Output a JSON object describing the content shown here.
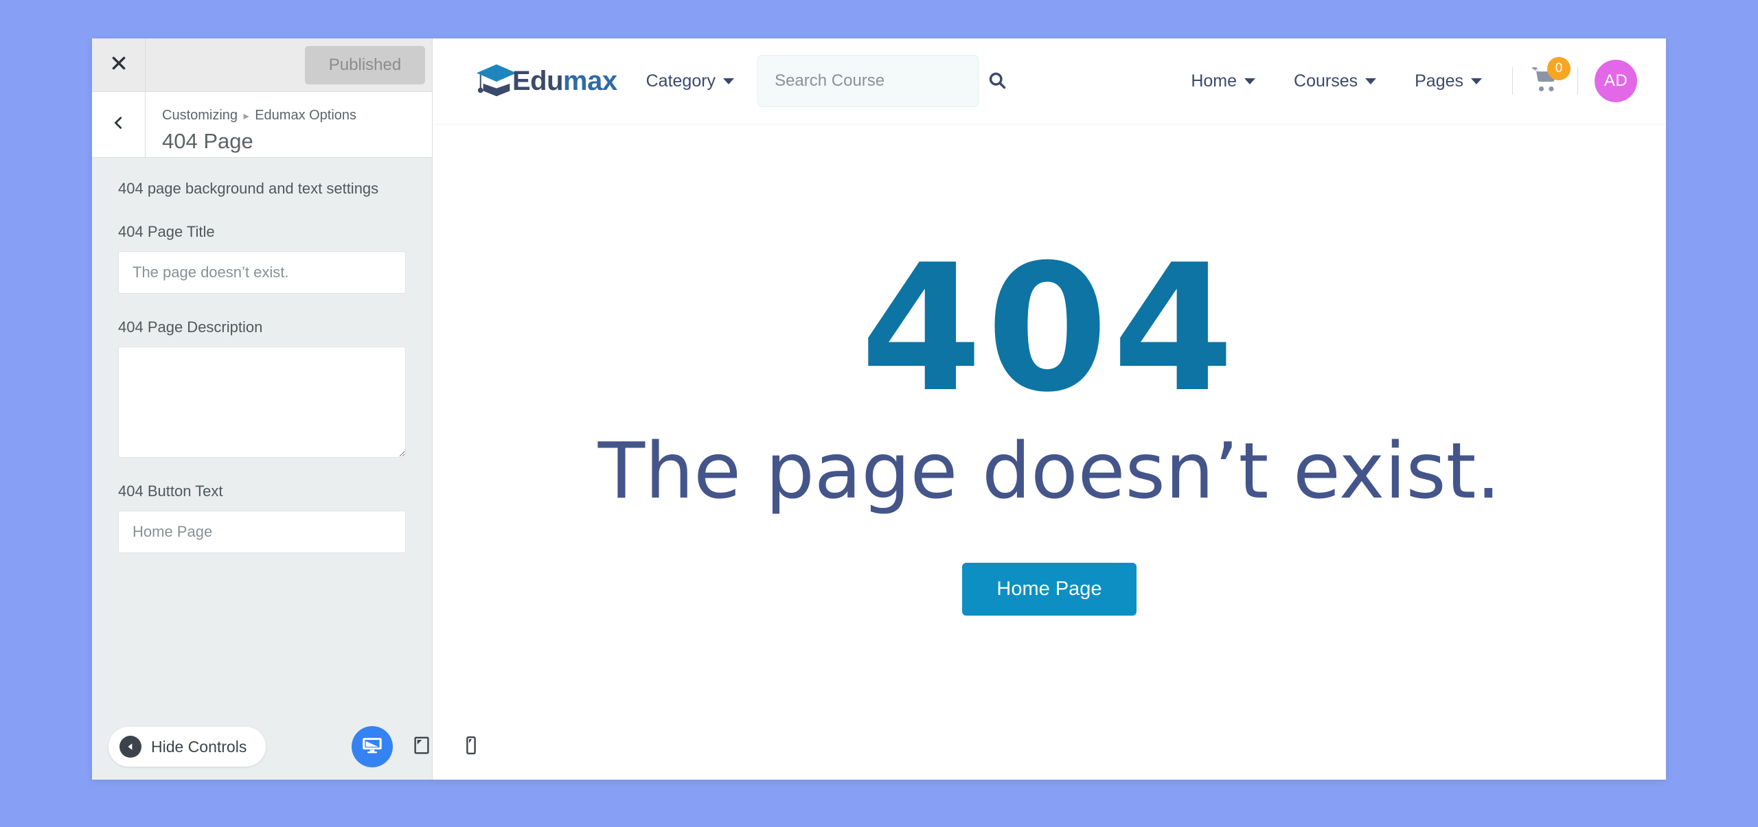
{
  "customizer": {
    "close_icon": "close-icon",
    "back_icon": "chevron-left-icon",
    "publish_label": "Published",
    "breadcrumb_root": "Customizing",
    "breadcrumb_separator": "▸",
    "breadcrumb_parent": "Edumax Options",
    "panel_title": "404 Page",
    "section_description": "404 page background and text settings",
    "fields": [
      {
        "label": "404 Page Title",
        "type": "text",
        "value": "",
        "placeholder": "The page doesn’t exist.",
        "name": "404-page-title-input"
      },
      {
        "label": "404 Page Description",
        "type": "textarea",
        "value": "",
        "placeholder": "",
        "name": "404-page-description-textarea"
      },
      {
        "label": "404 Button Text",
        "type": "text",
        "value": "",
        "placeholder": "Home Page",
        "name": "404-button-text-input"
      }
    ],
    "footer": {
      "hide_controls_label": "Hide Controls",
      "hide_controls_icon": "caret-left-circle-icon",
      "devices": [
        {
          "name": "desktop",
          "icon": "desktop-icon",
          "active": true
        },
        {
          "name": "tablet",
          "icon": "tablet-icon",
          "active": false
        },
        {
          "name": "mobile",
          "icon": "mobile-icon",
          "active": false
        }
      ]
    }
  },
  "preview": {
    "header": {
      "logo_icon": "graduation-cap-icon",
      "brand_dark": "Edu",
      "brand_light": "max",
      "category_label": "Category",
      "search": {
        "placeholder": "Search Course",
        "value": "",
        "icon": "search-icon"
      },
      "nav": [
        {
          "label": "Home"
        },
        {
          "label": "Courses"
        },
        {
          "label": "Pages"
        }
      ],
      "cart": {
        "icon": "cart-icon",
        "count": "0"
      },
      "avatar": {
        "initials": "AD"
      }
    },
    "error": {
      "code": "404",
      "title": "The page doesn’t exist.",
      "button_label": "Home Page"
    }
  },
  "colors": {
    "page_background": "#87a0f5",
    "customizer_background": "#eaeeee",
    "publish_button": "#cdcdcd",
    "device_active": "#3582f4",
    "error_code": "#0d74a3",
    "error_title": "#44558a",
    "error_button": "#0d8fc4",
    "brand_dark": "#3b4a6b",
    "brand_light": "#2f6ca5",
    "cart_badge": "#f5a623",
    "avatar": "#e268e8"
  }
}
